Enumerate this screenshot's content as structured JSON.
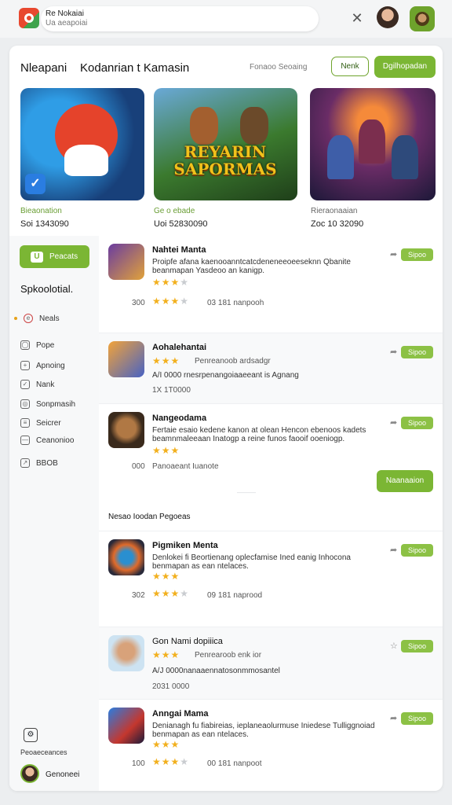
{
  "topbar": {
    "search_line1": "Re Nokaiai",
    "search_line2": "Ua aeapoiai"
  },
  "header": {
    "title": "Nleapani",
    "subtitle": "Kodanrian t Kamasin",
    "link": "Fonaoo Seoaing",
    "outline_button": "Nenk",
    "primary_button": "Dgilhopadan"
  },
  "featured": [
    {
      "label": "Bieaonation",
      "value": "Soi 1343090"
    },
    {
      "label": "Ge o ebade",
      "value": "Uoi 52830090",
      "banner": "REYARIN SAPORMAS"
    },
    {
      "label": "Rieraonaaian",
      "value": "Zoc 10 32090"
    }
  ],
  "sidebar": {
    "button": "Peacats",
    "heading": "Spkoolotial.",
    "items": [
      {
        "label": "Neals",
        "icon": "e"
      },
      {
        "label": "Pope",
        "icon": "◯"
      },
      {
        "label": "Apnoing",
        "icon": "+"
      },
      {
        "label": "Nank",
        "icon": "✓"
      },
      {
        "label": "Sonpmasih",
        "icon": "◎"
      },
      {
        "label": "Seicrer",
        "icon": "≡"
      },
      {
        "label": "Ceanonioo",
        "icon": "—"
      },
      {
        "label": "BBOB",
        "icon": "↗"
      }
    ],
    "footer_label": "Peoaeceances",
    "footer_name": "Genoneei"
  },
  "list": {
    "rows": [
      {
        "name": "Nahtei Manta",
        "desc": "Proipfe afana kaenooanntcatcdeneneeoeeseknn Qbanite beanmapan Yasdeoo an kanigp.",
        "stars_a": "★★★",
        "meta1": "300",
        "rating": "★★★",
        "meta2": "03 181  nanpooh",
        "action": "Sipoo"
      },
      {
        "name": "Aohalehantai",
        "desc": "A/I 0000 rnesrpenangoiaaeeant is Agnang",
        "stars_a": "★★★",
        "inline": "Penreanoob ardsadgr",
        "meta1": "1X 1T0000",
        "action": "Sipoo"
      },
      {
        "name": "Nangeodama",
        "desc": "Fertaie esaio kedene kanon at olean Hencon ebenoos kadets beamnmaleeaan Inatogp a reine funos faooif ooeniogp.",
        "stars_a": "★★★",
        "meta1": "000",
        "meta2": "Panoaeant Iuanote",
        "action": "Sipoo"
      },
      {
        "name": "Pigmiken Menta",
        "desc": "Denlokei fi Beortienang oplecfamise Ined eanig Inhocona benmapan as ean ntelaces.",
        "stars_a": "★★★",
        "meta1": "302",
        "rating": "★★★",
        "meta2": "09 181  naprood",
        "action": "Sipoo"
      },
      {
        "name": "Gon Nami dopiiica",
        "desc": "A/J 0000nanaaennatosonmmosantel",
        "stars_a": "★★★",
        "inline": "Penrearoob enk ior",
        "meta1": "2031 0000",
        "action": "Sipoo"
      },
      {
        "name": "Anngai Mama",
        "desc": "Denianagh fu fiabireias, ieplaneaolurmuse Iniedese Tulliggnoiad benmapan as ean ntelaces.",
        "stars_a": "★★★",
        "meta1": "100",
        "rating": "★★★",
        "meta2": "00 181  nanpoot",
        "action": "Sipoo"
      }
    ],
    "mid_button": "Naanaaion",
    "section_title": "Nesao Ioodan Pegoeas",
    "faint": "———"
  }
}
